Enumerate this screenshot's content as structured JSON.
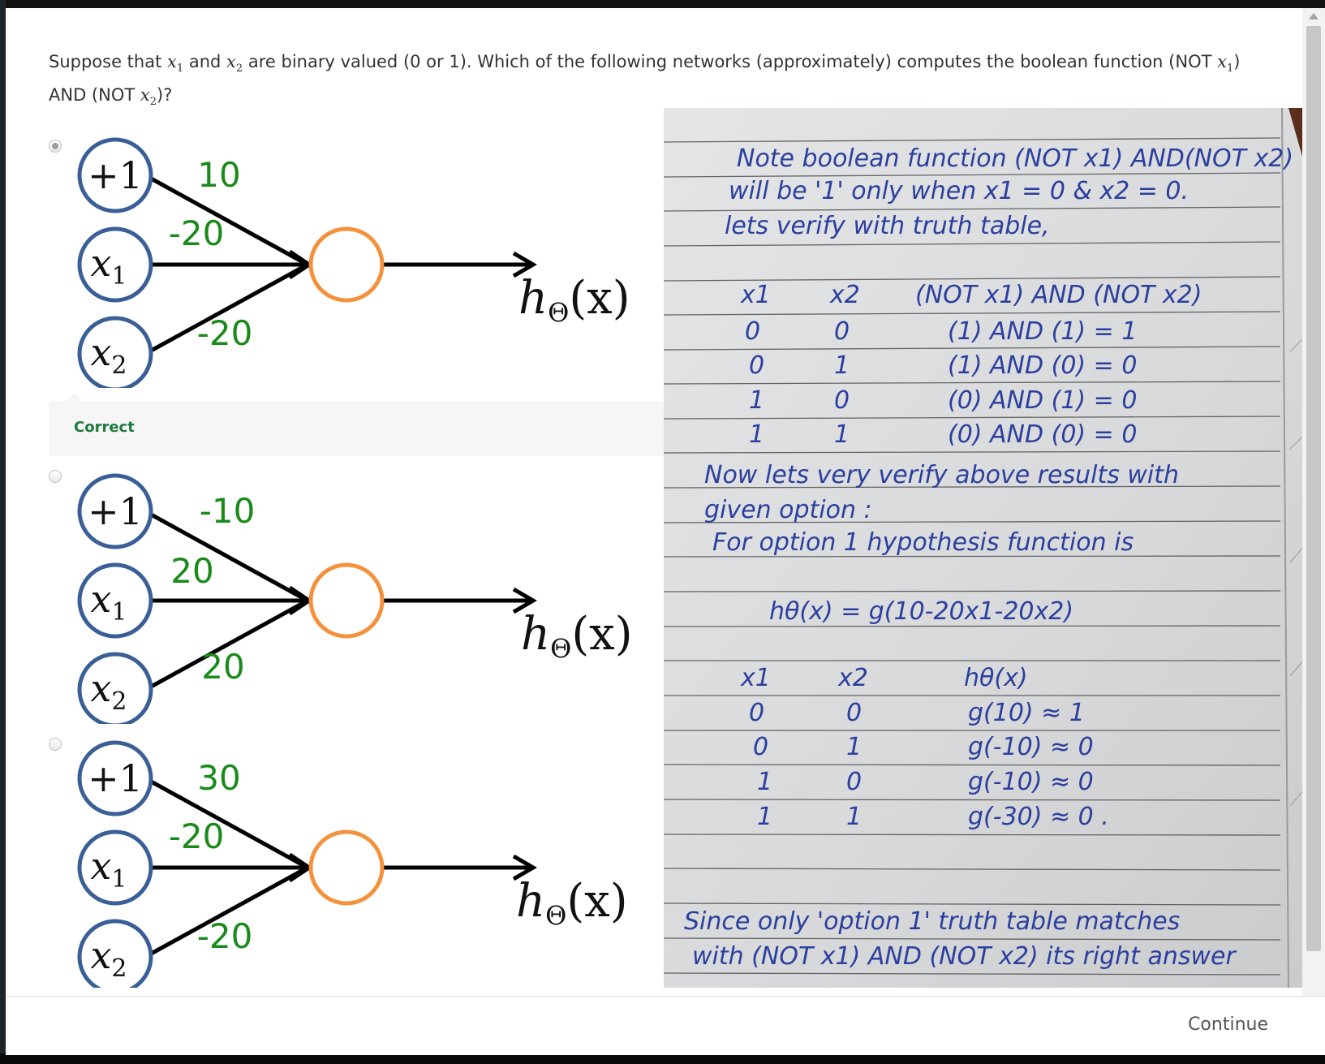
{
  "question": {
    "pre": "Suppose that",
    "x1": "x",
    "x1_sub": "1",
    "and": "and",
    "x2": "x",
    "x2_sub": "2",
    "mid": "are binary valued (0 or 1). Which of the following networks (approximately) computes the boolean function (NOT",
    "mid2": ") AND (NOT",
    "end": ")?"
  },
  "options": [
    {
      "selected": true,
      "bias_label": "+1",
      "x1_label": "x",
      "x1_sub": "1",
      "x2_label": "x",
      "x2_sub": "2",
      "w_bias": "10",
      "w_x1": "-20",
      "w_x2": "-20",
      "output_label": "h",
      "output_sub": "Θ",
      "output_arg": "(x)"
    },
    {
      "selected": false,
      "bias_label": "+1",
      "x1_label": "x",
      "x1_sub": "1",
      "x2_label": "x",
      "x2_sub": "2",
      "w_bias": "-10",
      "w_x1": "20",
      "w_x2": "20",
      "output_label": "h",
      "output_sub": "Θ",
      "output_arg": "(x)"
    },
    {
      "selected": false,
      "bias_label": "+1",
      "x1_label": "x",
      "x1_sub": "1",
      "x2_label": "x",
      "x2_sub": "2",
      "w_bias": "30",
      "w_x1": "-20",
      "w_x2": "-20",
      "output_label": "h",
      "output_sub": "Θ",
      "output_arg": "(x)"
    }
  ],
  "feedback": {
    "label": "Correct"
  },
  "note_lines": [
    "Note boolean function (NOT x1) AND(NOT x2)",
    "will be '1' only when x1 = 0 & x2 = 0.",
    "lets verify with truth table,",
    "x1",
    "x2",
    "(NOT x1) AND (NOT x2)",
    "0",
    "0",
    "(1) AND (1) = 1",
    "0",
    "1",
    "(1) AND (0) = 0",
    "1",
    "0",
    "(0) AND (1) = 0",
    "1",
    "1",
    "(0) AND (0) = 0",
    "Now lets very verify above results with",
    "given option :",
    "For option 1 hypothesis function is",
    "hθ(x) = g(10-20x1-20x2)",
    "x1",
    "x2",
    "hθ(x)",
    "0",
    "0",
    "g(10) ≈ 1",
    "0",
    "1",
    "g(-10) ≈ 0",
    "1",
    "0",
    "g(-10) ≈ 0",
    "1",
    "1",
    "g(-30) ≈ 0 .",
    "Since only 'option 1' truth table matches",
    "with (NOT x1) AND (NOT x2) its right answer"
  ],
  "colors": {
    "input_node": "#3a5f96",
    "output_node": "#f4913c",
    "weight_text": "#1a8a1a",
    "correct_text": "#1f7a3d",
    "ink": "#2b3f9e"
  },
  "footer": {
    "continue_label": "Continue"
  }
}
